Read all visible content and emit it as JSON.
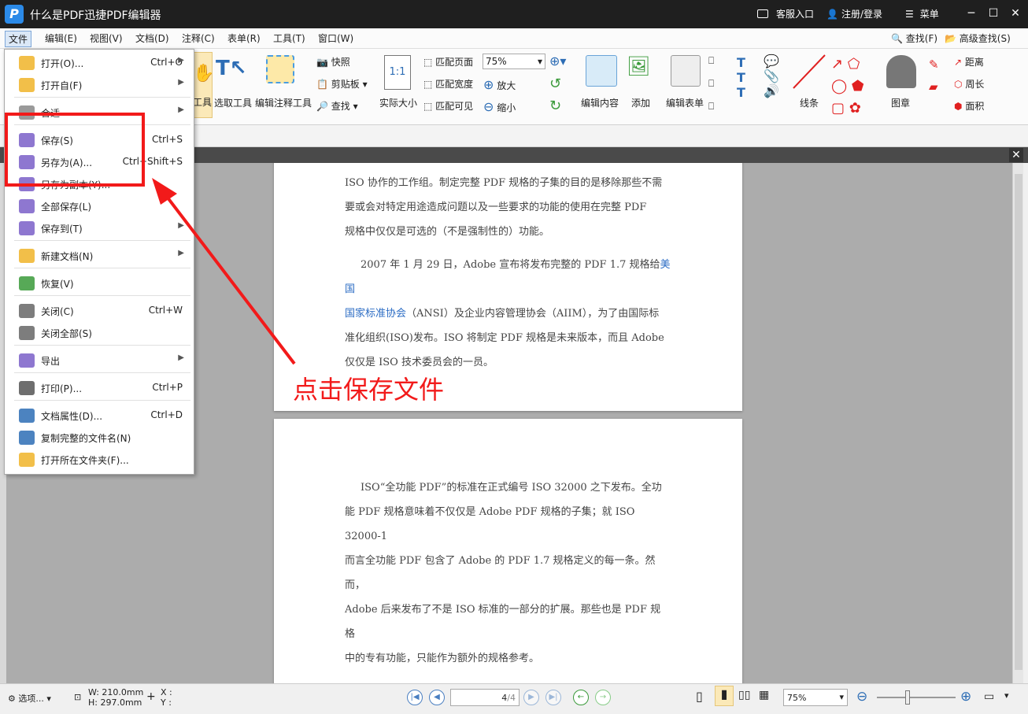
{
  "window": {
    "title": "什么是PDF迅捷PDF编辑器",
    "app_icon": "P",
    "service": "客服入口",
    "login": "注册/登录",
    "menu": "菜单"
  },
  "menubar": [
    "文件",
    "编辑(E)",
    "视图(V)",
    "文档(D)",
    "注释(C)",
    "表单(R)",
    "工具(T)",
    "窗口(W)"
  ],
  "menubar_right": {
    "find": "查找(F)",
    "advanced_find": "高级查找(S)"
  },
  "ribbon": {
    "hand_partial": "工具",
    "select_tool": "选取工具",
    "edit_annot": "编辑注释工具",
    "snapshot": "快照",
    "clipboard": "剪贴板",
    "find": "查找",
    "actual_size": "实际大小",
    "actual_size_glyph": "1:1",
    "fit_page": "匹配页面",
    "fit_width": "匹配宽度",
    "fit_visible": "匹配可见",
    "zoom_value": "75%",
    "zoom_in": "放大",
    "zoom_out": "缩小",
    "edit_content": "编辑内容",
    "add": "添加",
    "edit_form": "编辑表单",
    "line": "线条",
    "stamp": "图章",
    "distance": "距离",
    "perimeter": "周长",
    "area": "面积"
  },
  "file_menu": [
    {
      "label": "打开(O)...",
      "shortcut": "Ctrl+O",
      "arrow": true
    },
    {
      "label": "打开自(F)",
      "shortcut": "",
      "arrow": true
    },
    {
      "label": "合适",
      "shortcut": "",
      "arrow": true
    },
    {
      "label": "保存(S)",
      "shortcut": "Ctrl+S",
      "arrow": false
    },
    {
      "label": "另存为(A)...",
      "shortcut": "Ctrl+Shift+S",
      "arrow": false
    },
    {
      "label": "另存为副本(Y)...",
      "shortcut": "",
      "arrow": false
    },
    {
      "label": "全部保存(L)",
      "shortcut": "",
      "arrow": false
    },
    {
      "label": "保存到(T)",
      "shortcut": "",
      "arrow": true
    },
    {
      "label": "新建文档(N)",
      "shortcut": "",
      "arrow": true
    },
    {
      "label": "恢复(V)",
      "shortcut": "",
      "arrow": false
    },
    {
      "label": "关闭(C)",
      "shortcut": "Ctrl+W",
      "arrow": false
    },
    {
      "label": "关闭全部(S)",
      "shortcut": "",
      "arrow": false
    },
    {
      "label": "导出",
      "shortcut": "",
      "arrow": true
    },
    {
      "label": "打印(P)...",
      "shortcut": "Ctrl+P",
      "arrow": false
    },
    {
      "label": "文档属性(D)...",
      "shortcut": "Ctrl+D",
      "arrow": false
    },
    {
      "label": "复制完整的文件名(N)",
      "shortcut": "",
      "arrow": false
    },
    {
      "label": "打开所在文件夹(F)...",
      "shortcut": "",
      "arrow": false
    }
  ],
  "annotation": {
    "callout": "点击保存文件",
    "color": "#f21a1a"
  },
  "page1": {
    "p1": [
      "ISO 协作的工作组。制定完整 PDF 规格的子集的目的是移除那些不需",
      "要或会对特定用途造成问题以及一些要求的功能的使用在完整 PDF",
      "规格中仅仅是可选的（不是强制性的）功能。"
    ],
    "p2_start": "2007 年 1 月 29 日，Adobe 宣布将发布完整的 PDF 1.7 规格给",
    "p2_link1": "美国",
    "p2_link2": "国家标准协会",
    "p2_rest": "（ANSI）及企业内容管理协会（AIIM），为了由国际标",
    "p2_lines": [
      "准化组织(ISO)发布。ISO 将制定 PDF 规格是未来版本，而且 Adobe",
      "仅仅是 ISO 技术委员会的一员。"
    ]
  },
  "page2": {
    "lines": [
      "ISO“全功能 PDF”的标准在正式编号 ISO 32000 之下发布。全功",
      "能 PDF 规格意味着不仅仅是 Adobe PDF 规格的子集；就 ISO 32000-1",
      "而言全功能 PDF 包含了 Adobe 的 PDF 1.7 规格定义的每一条。然而，",
      "Adobe 后来发布了不是 ISO 标准的一部分的扩展。那些也是 PDF 规格",
      "中的专有功能，只能作为额外的规格参考。"
    ]
  },
  "status": {
    "options": "选项...",
    "width": "W: 210.0mm",
    "height": "H: 297.0mm",
    "x": "X :",
    "y": "Y :",
    "page_current": "4",
    "page_total": "/4",
    "zoom": "75%"
  }
}
